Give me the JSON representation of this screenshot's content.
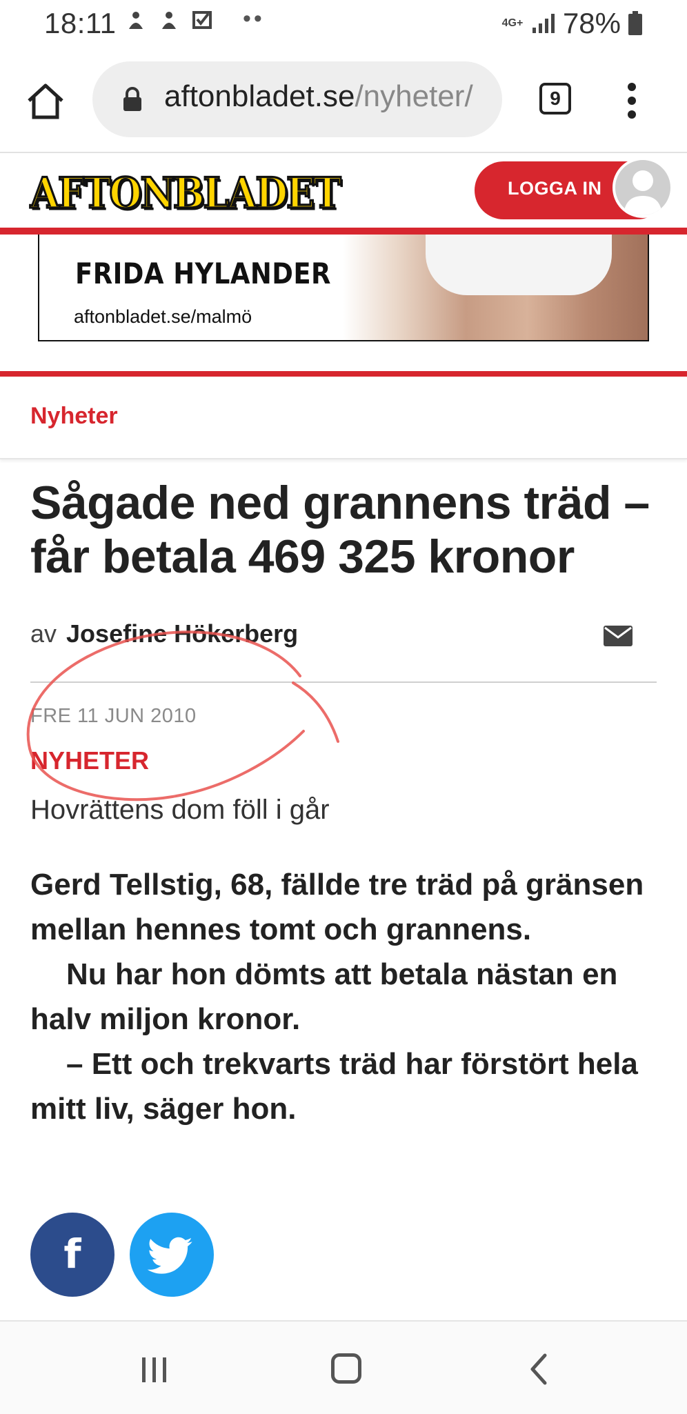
{
  "status_bar": {
    "time": "18:11",
    "network": "4G+",
    "battery": "78%"
  },
  "browser": {
    "url_host": "aftonbladet.se",
    "url_path": "/nyheter/",
    "tab_count": "9"
  },
  "site": {
    "logo": "AFTONBLADET",
    "login_label": "LOGGA IN",
    "accent": "#d7262e"
  },
  "ad": {
    "title": "FRIDA HYLANDER",
    "url": "aftonbladet.se/malmö"
  },
  "section": {
    "label": "Nyheter"
  },
  "article": {
    "headline": "Sågade ned grannens träd – får betala 469 325 kronor",
    "byline_prefix": "av",
    "author": "Josefine Hökerberg",
    "date": "FRE 11 JUN 2010",
    "category": "NYHETER",
    "subtitle": "Hovrättens dom föll i går",
    "ingress": [
      "Gerd Tellstig, 68, fällde tre träd på gränsen mellan hennes tomt och grannens.",
      "Nu har hon dömts att betala nästan en halv miljon kronor.",
      "– Ett och trekvarts träd har förstört hela mitt liv, säger hon."
    ]
  },
  "share": {
    "facebook": "f",
    "facebook_color": "#2c4c8c",
    "twitter_color": "#1da1f2"
  }
}
